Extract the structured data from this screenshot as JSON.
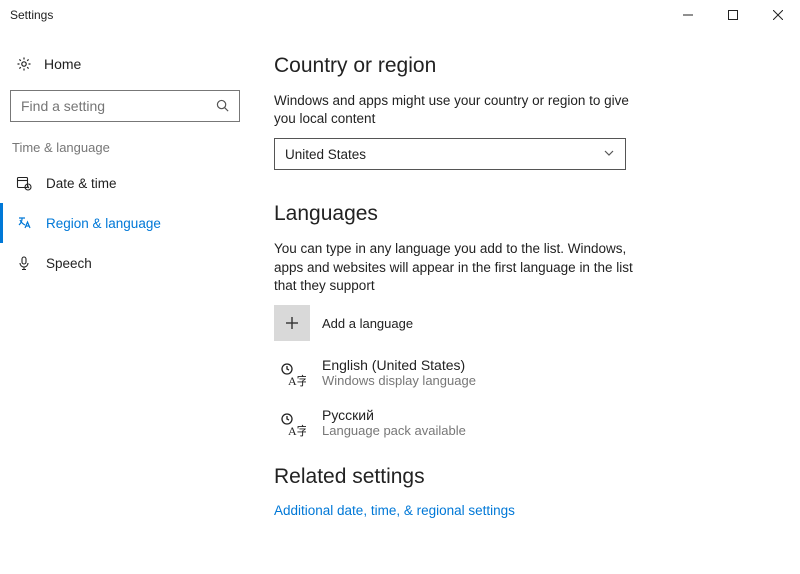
{
  "window": {
    "title": "Settings"
  },
  "sidebar": {
    "home": "Home",
    "search_placeholder": "Find a setting",
    "category": "Time & language",
    "items": [
      {
        "label": "Date & time"
      },
      {
        "label": "Region & language"
      },
      {
        "label": "Speech"
      }
    ]
  },
  "content": {
    "country_heading": "Country or region",
    "country_desc": "Windows and apps might use your country or region to give you local content",
    "country_value": "United States",
    "languages_heading": "Languages",
    "languages_desc": "You can type in any language you add to the list. Windows, apps and websites will appear in the first language in the list that they support",
    "add_language": "Add a language",
    "langs": [
      {
        "name": "English (United States)",
        "sub": "Windows display language"
      },
      {
        "name": "Русский",
        "sub": "Language pack available"
      }
    ],
    "related_heading": "Related settings",
    "related_link": "Additional date, time, & regional settings"
  }
}
